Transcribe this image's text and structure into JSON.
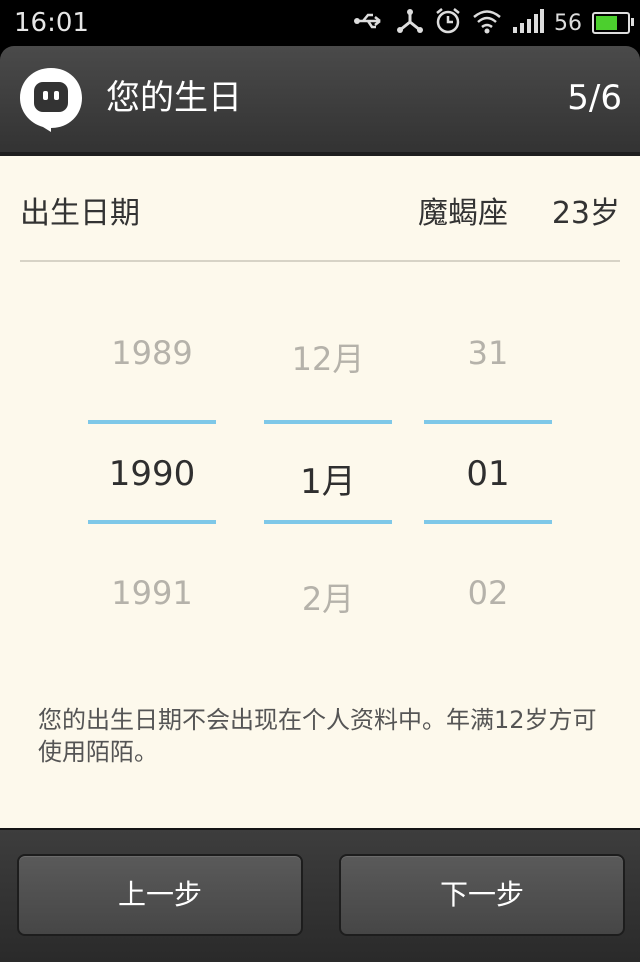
{
  "status_bar": {
    "time": "16:01",
    "signal_number": "56",
    "battery_level": 0.8,
    "icons": [
      "usb-icon",
      "transfer-icon",
      "alarm-icon",
      "wifi-icon",
      "signal-icon",
      "battery-icon"
    ]
  },
  "header": {
    "title": "您的生日",
    "step": "5/6",
    "logo": "momo-chat-logo"
  },
  "birth": {
    "label": "出生日期",
    "zodiac": "魔蝎座",
    "age": "23岁"
  },
  "picker": {
    "year": {
      "prev": "1989",
      "selected": "1990",
      "next": "1991"
    },
    "month": {
      "prev": "12月",
      "selected": "1月",
      "next": "2月"
    },
    "day": {
      "prev": "31",
      "selected": "01",
      "next": "02"
    }
  },
  "note": "您的出生日期不会出现在个人资料中。年满12岁方可使用陌陌。",
  "buttons": {
    "prev": "上一步",
    "next": "下一步"
  },
  "colors": {
    "accent_line": "#7ec8e8",
    "content_bg": "#fdf9ec",
    "battery_fill": "#4ccf2e"
  }
}
